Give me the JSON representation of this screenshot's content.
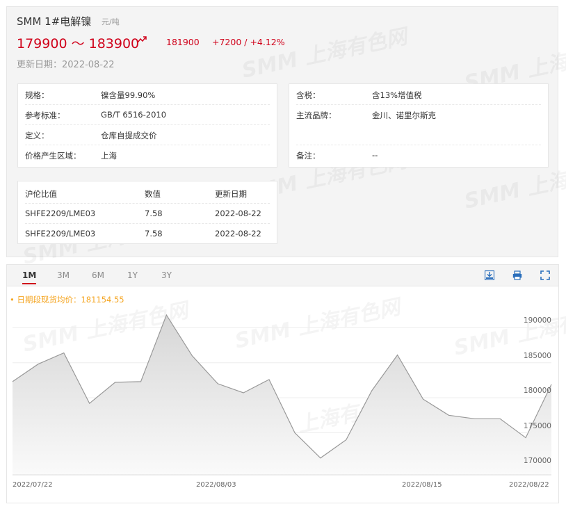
{
  "header": {
    "title": "SMM 1#电解镍",
    "unit": "元/吨",
    "price_range": "179900 ～ 183900",
    "avg_price": "181900",
    "change": "+7200  /  +4.12%",
    "update_date": "更新日期：2022-08-22"
  },
  "watermark": "SMM 上海有色网",
  "spec_left": [
    {
      "label": "规格：",
      "value": "镍含量99.90%"
    },
    {
      "label": "参考标准：",
      "value": "GB/T 6516-2010"
    },
    {
      "label": "定义：",
      "value": "仓库自提成交价"
    },
    {
      "label": "价格产生区域：",
      "value": "上海"
    }
  ],
  "spec_right": [
    {
      "label": "含税：",
      "value": "含13%增值税"
    },
    {
      "label": "主流品牌：",
      "value": "金川、诺里尔斯克"
    },
    {
      "label": "备注：",
      "value": "--"
    }
  ],
  "ratio_table": {
    "headers": [
      "沪伦比值",
      "数值",
      "更新日期"
    ],
    "rows": [
      [
        "SHFE2209/LME03",
        "7.58",
        "2022-08-22"
      ],
      [
        "SHFE2209/LME03",
        "7.58",
        "2022-08-22"
      ]
    ]
  },
  "tabs": [
    "1M",
    "3M",
    "6M",
    "1Y",
    "3Y"
  ],
  "active_tab": "1M",
  "tools": [
    "download-image-icon",
    "print-icon",
    "fullscreen-icon"
  ],
  "avg_label": "• 日期段现货均价：181154.55",
  "chart_data": {
    "type": "area",
    "x": [
      "2022-07-22",
      "2022-07-25",
      "2022-07-26",
      "2022-07-27",
      "2022-07-28",
      "2022-07-29",
      "2022-08-01",
      "2022-08-02",
      "2022-08-03",
      "2022-08-04",
      "2022-08-05",
      "2022-08-08",
      "2022-08-09",
      "2022-08-10",
      "2022-08-11",
      "2022-08-12",
      "2022-08-15",
      "2022-08-16",
      "2022-08-17",
      "2022-08-18",
      "2022-08-19",
      "2022-08-22"
    ],
    "values": [
      182300,
      184800,
      186400,
      179200,
      182200,
      182300,
      191800,
      186000,
      182000,
      180700,
      182600,
      175000,
      171400,
      174000,
      181000,
      186100,
      179800,
      177500,
      177000,
      177000,
      174300,
      181900
    ],
    "x_tick_labels": [
      "2022/07/22",
      "2022/08/03",
      "2022/08/15",
      "2022/08/22"
    ],
    "y_ticks": [
      170000,
      175000,
      180000,
      185000,
      190000
    ],
    "ylim": [
      169000,
      193500
    ],
    "line_color": "#999999",
    "fill_color": "#e4e4e4",
    "accent": "#d0021b"
  }
}
